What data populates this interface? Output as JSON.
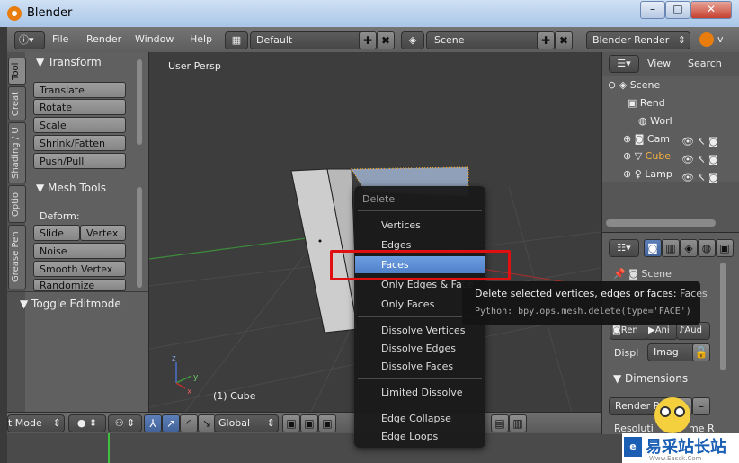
{
  "window": {
    "title": "Blender",
    "btn_min": "–",
    "btn_max": "□",
    "btn_close": "✕"
  },
  "header": {
    "info_icon": "info-icon",
    "menus": [
      "File",
      "Render",
      "Window",
      "Help"
    ],
    "screen_layout": "Default",
    "scene": "Scene",
    "render_engine": "Blender Render",
    "version_partial": "v"
  },
  "toolshelf": {
    "tabs": [
      "Tool",
      "Creat",
      "Shading / U",
      "Optio",
      "Grease Pen"
    ],
    "transform": {
      "title": "Transform",
      "buttons": [
        "Translate",
        "Rotate",
        "Scale",
        "Shrink/Fatten",
        "Push/Pull"
      ]
    },
    "mesh_tools": {
      "title": "Mesh Tools",
      "deform_label": "Deform:",
      "slide_edge": "Slide Ed",
      "vertex": "Vertex",
      "buttons": [
        "Noise",
        "Smooth Vertex",
        "Randomize"
      ]
    },
    "toggle_editmode": "Toggle Editmode"
  },
  "viewport": {
    "view_label": "User Persp",
    "object_label": "(1) Cube"
  },
  "context_menu": {
    "title": "Delete",
    "items": [
      "Vertices",
      "Edges",
      "Faces",
      "Only Edges & Face",
      "Only Faces"
    ],
    "items2": [
      "Dissolve Vertices",
      "Dissolve Edges",
      "Dissolve Faces"
    ],
    "items3": [
      "Limited Dissolve"
    ],
    "items4": [
      "Edge Collapse",
      "Edge Loops"
    ]
  },
  "tooltip": {
    "text": "Delete selected vertices, edges or faces:",
    "value": "Faces",
    "python": "Python: bpy.ops.mesh.delete(type='FACE')"
  },
  "bottombar": {
    "mode": "t Mode",
    "orientation": "Global"
  },
  "outliner": {
    "view": "View",
    "search": "Search",
    "items": [
      {
        "label": "Scene"
      },
      {
        "label": "Rend"
      },
      {
        "label": "Worl"
      },
      {
        "label": "Cam"
      },
      {
        "label": "Cube"
      },
      {
        "label": "Lamp"
      }
    ]
  },
  "properties": {
    "scene_label": "Scene",
    "render_tabs": [
      "Ren",
      "Ani",
      "Aud"
    ],
    "display_label": "Displ",
    "display_value": "Imag",
    "dimensions": "Dimensions",
    "render_presets": "Render P",
    "resolution": "Resoluti",
    "frame_range": "me R"
  },
  "watermark": {
    "text": "易采站长站",
    "sub": "Www.Easck.Com"
  },
  "colors": {
    "accent": "#5680c2",
    "highlight_red": "#e01010",
    "selection_orange": "#f5a623"
  }
}
